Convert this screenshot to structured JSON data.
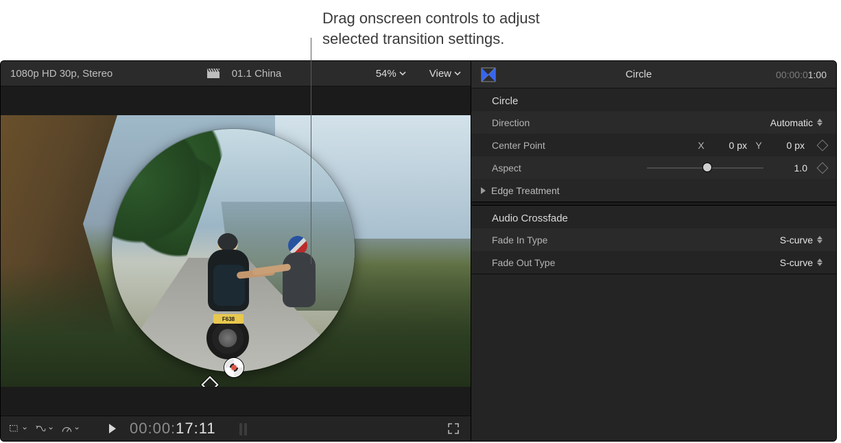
{
  "annotation": {
    "text": "Drag onscreen controls to adjust\nselected transition settings."
  },
  "viewer": {
    "format_label": "1080p HD 30p, Stereo",
    "clip_name": "01.1 China",
    "zoom_label": "54%",
    "view_label": "View",
    "license_plate": "F638",
    "transport": {
      "timecode_prefix": "00:00:",
      "timecode_main": "17:11"
    }
  },
  "inspector": {
    "title": "Circle",
    "timecode_prefix": "00:00:0",
    "timecode_main": "1:00",
    "sections": {
      "circle": {
        "header": "Circle",
        "direction": {
          "label": "Direction",
          "value": "Automatic"
        },
        "center_point": {
          "label": "Center Point",
          "x_label": "X",
          "x_value": "0 px",
          "y_label": "Y",
          "y_value": "0 px"
        },
        "aspect": {
          "label": "Aspect",
          "value": "1.0"
        },
        "edge_treatment": {
          "label": "Edge Treatment"
        }
      },
      "audio_crossfade": {
        "header": "Audio Crossfade",
        "fade_in": {
          "label": "Fade In Type",
          "value": "S-curve"
        },
        "fade_out": {
          "label": "Fade Out Type",
          "value": "S-curve"
        }
      }
    }
  }
}
